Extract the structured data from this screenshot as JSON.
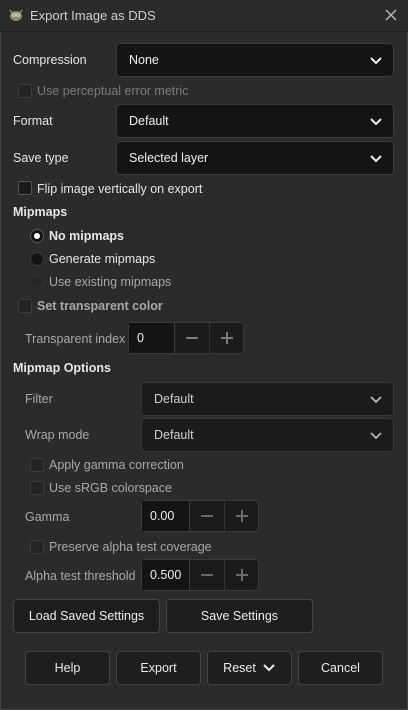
{
  "window": {
    "title": "Export Image as DDS",
    "app_icon": "gimp-icon",
    "close_icon": "close-icon"
  },
  "compression": {
    "label": "Compression",
    "value": "None"
  },
  "perceptual": {
    "label": "Use perceptual error metric",
    "checked": false,
    "enabled": false
  },
  "format": {
    "label": "Format",
    "value": "Default"
  },
  "save_type": {
    "label": "Save type",
    "value": "Selected layer"
  },
  "flip": {
    "label": "Flip image vertically on export",
    "checked": false
  },
  "mipmaps": {
    "heading": "Mipmaps",
    "options": [
      {
        "label": "No mipmaps",
        "selected": true,
        "enabled": true
      },
      {
        "label": "Generate mipmaps",
        "selected": false,
        "enabled": true
      },
      {
        "label": "Use existing mipmaps",
        "selected": false,
        "enabled": false
      }
    ]
  },
  "transparent": {
    "check_label": "Set transparent color",
    "index_label": "Transparent index",
    "index_value": "0"
  },
  "mipmap_options": {
    "heading": "Mipmap Options",
    "filter_label": "Filter",
    "filter_value": "Default",
    "wrap_label": "Wrap mode",
    "wrap_value": "Default",
    "gamma_correction_label": "Apply gamma correction",
    "srgb_label": "Use sRGB colorspace",
    "gamma_label": "Gamma",
    "gamma_value": "0.00",
    "preserve_alpha_label": "Preserve alpha test coverage",
    "alpha_threshold_label": "Alpha test threshold",
    "alpha_threshold_value": "0.500"
  },
  "settings_buttons": {
    "load": "Load Saved Settings",
    "save": "Save Settings"
  },
  "footer": {
    "help": "Help",
    "export": "Export",
    "reset": "Reset",
    "cancel": "Cancel"
  },
  "colors": {
    "background": "#2b2b2b",
    "field": "#141414",
    "text": "#e6e6e6",
    "dim_text": "#a8a8a8"
  }
}
